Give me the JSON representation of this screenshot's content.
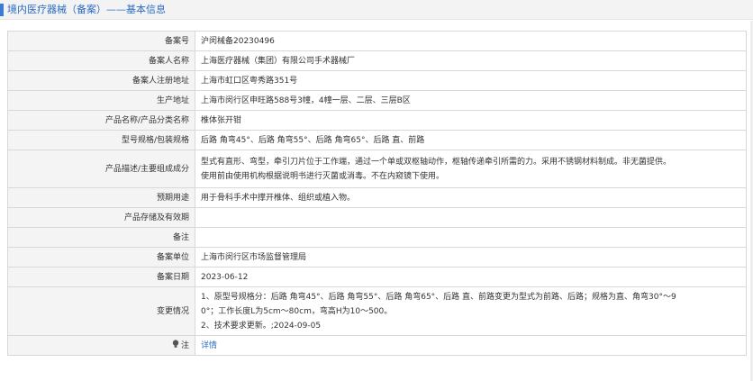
{
  "header": {
    "title": "境内医疗器械（备案）——基本信息"
  },
  "rows": [
    {
      "label": "备案号",
      "lines": [
        "沪闵械备20230496"
      ]
    },
    {
      "label": "备案人名称",
      "lines": [
        "上海医疗器械（集团）有限公司手术器械厂"
      ]
    },
    {
      "label": "备案人注册地址",
      "lines": [
        "上海市虹口区粤秀路351号"
      ]
    },
    {
      "label": "生产地址",
      "lines": [
        "上海市闵行区申旺路588号3幢，4幢一层、二层、三层B区"
      ]
    },
    {
      "label": "产品名称/产品分类名称",
      "lines": [
        "椎体张开钳"
      ]
    },
    {
      "label": "型号规格/包装规格",
      "lines": [
        "后路 角弯45°、后路 角弯55°、后路 角弯65°、后路 直、前路"
      ]
    },
    {
      "label": "产品描述/主要组成成分",
      "lines": [
        "型式有直形、弯型，牵引刀片位于工作端，通过一个单或双枢轴动作，枢轴传递牵引所需的力。采用不锈钢材料制成。非无菌提供。",
        "使用前由使用机构根据说明书进行灭菌或消毒。不在内窥镜下使用。"
      ]
    },
    {
      "label": "预期用途",
      "lines": [
        "用于骨科手术中撑开椎体、组织或植入物。"
      ]
    },
    {
      "label": "产品存储及有效期",
      "lines": [
        ""
      ]
    },
    {
      "label": "备注",
      "lines": [
        ""
      ]
    },
    {
      "label": "备案单位",
      "lines": [
        "上海市闵行区市场监督管理局"
      ]
    },
    {
      "label": "备案日期",
      "lines": [
        "2023-06-12"
      ]
    },
    {
      "label": "变更情况",
      "lines": [
        "1、原型号规格分：后路 角弯45°、后路 角弯55°、后路 角弯65°、后路 直、前路变更为型式为前路、后路；规格为直、角弯30°～9",
        "0°；工作长度L为5cm～80cm，弯高H为10～500。",
        "2、技术要求更新。;2024-09-05"
      ]
    }
  ],
  "note_row": {
    "label": "注",
    "link": "详情",
    "icon": "bulb-icon"
  }
}
